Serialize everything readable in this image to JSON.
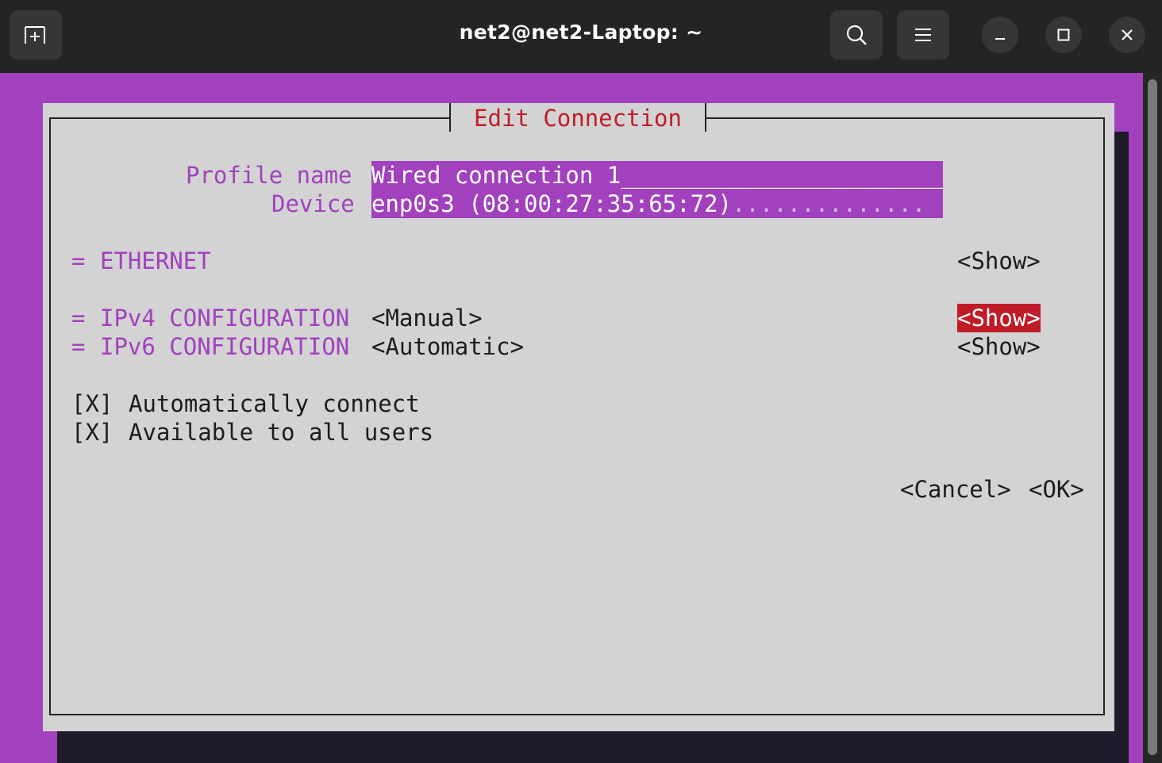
{
  "window": {
    "title": "net2@net2-Laptop: ~",
    "buttons": {
      "new_tab": "new-tab-icon",
      "search": "search-icon",
      "menu": "hamburger-menu-icon",
      "minimize": "minimize-icon",
      "maximize": "maximize-icon",
      "close": "close-icon"
    }
  },
  "dialog": {
    "title": "Edit Connection",
    "profile_name_label": "Profile name",
    "profile_name_value": "Wired connection 1",
    "profile_name_fill": "________________________",
    "device_label": "Device",
    "device_value": "enp0s3 (08:00:27:35:65:72)",
    "device_fill": "..............",
    "sections": [
      {
        "prefix": "=",
        "label": "ETHERNET",
        "value": "",
        "action": "<Show>"
      },
      {
        "prefix": "=",
        "label": "IPv4 CONFIGURATION",
        "value": "<Manual>",
        "action": "<Show>",
        "focused": true
      },
      {
        "prefix": "=",
        "label": "IPv6 CONFIGURATION",
        "value": "<Automatic>",
        "action": "<Show>"
      }
    ],
    "checkboxes": [
      {
        "mark": "[X]",
        "label": "Automatically connect"
      },
      {
        "mark": "[X]",
        "label": "Available to all users"
      }
    ],
    "cancel": "<Cancel>",
    "ok": "<OK>"
  },
  "colors": {
    "terminal_bg": "#a141bd",
    "dialog_bg": "#d3d3d3",
    "title_red": "#c01c28",
    "label_purple": "#a141bd",
    "titlebar_bg": "#242424"
  }
}
